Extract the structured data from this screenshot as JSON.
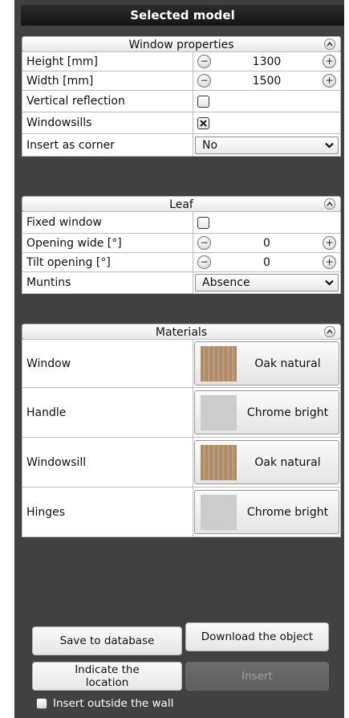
{
  "panel_title": "Selected model",
  "window_properties": {
    "header": "Window properties",
    "rows": [
      {
        "label": "Height [mm]",
        "value": "1300"
      },
      {
        "label": "Width [mm]",
        "value": "1500"
      },
      {
        "label": "Vertical reflection",
        "checked": false
      },
      {
        "label": "Windowsills",
        "checked": true
      },
      {
        "label": "Insert as corner",
        "selected": "No"
      }
    ]
  },
  "leaf": {
    "header": "Leaf",
    "rows": [
      {
        "label": "Fixed window",
        "checked": false
      },
      {
        "label": "Opening wide [°]",
        "value": "0"
      },
      {
        "label": "Tilt opening [°]",
        "value": "0"
      },
      {
        "label": "Muntins",
        "selected": "Absence"
      }
    ]
  },
  "materials": {
    "header": "Materials",
    "rows": [
      {
        "label": "Window",
        "material": "Oak natural",
        "swatch": "oak"
      },
      {
        "label": "Handle",
        "material": "Chrome bright",
        "swatch": "chrome"
      },
      {
        "label": "Windowsill",
        "material": "Oak natural",
        "swatch": "oak"
      },
      {
        "label": "Hinges",
        "material": "Chrome bright",
        "swatch": "chrome"
      }
    ]
  },
  "buttons": {
    "save": "Save to database",
    "download": "Download the object",
    "indicate": "Indicate the location",
    "insert": "Insert"
  },
  "insert_outside": {
    "label": "Insert outside the wall",
    "checked": false
  },
  "colors": {
    "panel_bg": "#414141",
    "title_bg": "#1e1e1e",
    "oak": "#b89574",
    "chrome": "#cccccc"
  }
}
